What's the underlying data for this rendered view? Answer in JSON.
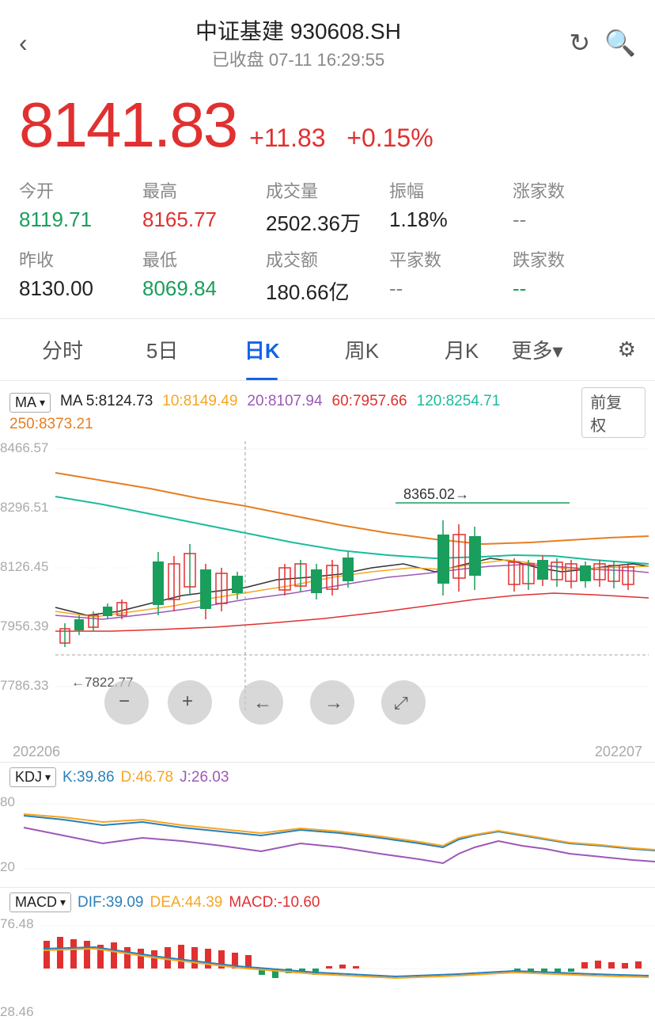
{
  "header": {
    "title": "中证基建 930608.SH",
    "subtitle": "已收盘 07-11 16:29:55",
    "back_label": "‹",
    "refresh_label": "↻",
    "search_label": "🔍"
  },
  "price": {
    "value": "8141.83",
    "change": "+11.83",
    "change_pct": "+0.15%"
  },
  "stats": {
    "row1": [
      {
        "label": "今开",
        "value": "8119.71",
        "color": "green"
      },
      {
        "label": "最高",
        "value": "8165.77",
        "color": "red"
      },
      {
        "label": "成交量",
        "value": "2502.36万",
        "color": "normal"
      },
      {
        "label": "振幅",
        "value": "1.18%",
        "color": "normal"
      },
      {
        "label": "涨家数",
        "value": "--",
        "color": "dash"
      }
    ],
    "row2": [
      {
        "label": "昨收",
        "value": "8130.00",
        "color": "normal"
      },
      {
        "label": "最低",
        "value": "8069.84",
        "color": "green"
      },
      {
        "label": "成交额",
        "value": "180.66亿",
        "color": "normal"
      },
      {
        "label": "平家数",
        "value": "--",
        "color": "dash"
      },
      {
        "label": "跌家数",
        "value": "--",
        "color": "dash"
      }
    ]
  },
  "tabs": [
    "分时",
    "5日",
    "日K",
    "周K",
    "月K",
    "更多▾"
  ],
  "active_tab": "日K",
  "ma_info": {
    "badge": "MA",
    "values": [
      {
        "label": "5:",
        "value": "8124.73",
        "color": "#222"
      },
      {
        "label": "10:",
        "value": "8149.49",
        "color": "#f5a623"
      },
      {
        "label": "20:",
        "value": "8107.94",
        "color": "#9b59b6"
      },
      {
        "label": "60:",
        "value": "7957.66",
        "color": "#e03030"
      },
      {
        "label": "120:",
        "value": "8254.71",
        "color": "#1abc9c"
      },
      {
        "label": "250:",
        "value": "8373.21",
        "color": "#e67e22"
      }
    ],
    "fuquan": "前复权"
  },
  "chart": {
    "y_labels": [
      "8466.57",
      "8296.51",
      "8126.45",
      "7956.39",
      "7786.33"
    ],
    "crosshair_label": "←7822.77",
    "arrow_label": "8365.02→",
    "dates": [
      "202206",
      "202207"
    ]
  },
  "controls": [
    "-",
    "+",
    "←",
    "→",
    "⤢"
  ],
  "kdj": {
    "badge": "KDJ",
    "values": "K:39.86  D:46.78  J:26.03",
    "k_color": "#2980b9",
    "d_color": "#f5a623",
    "j_color": "#9b59b6",
    "y_labels": [
      "80",
      "20"
    ]
  },
  "macd": {
    "badge": "MACD",
    "values": "DIF:39.09  DEA:44.39  MACD:-10.60",
    "dif_color": "#2980b9",
    "dea_color": "#f5a623",
    "y_labels": [
      "76.48",
      "28.46"
    ]
  }
}
